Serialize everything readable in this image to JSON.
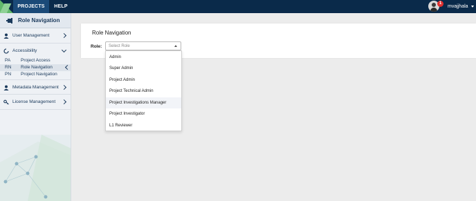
{
  "topbar": {
    "tabs": [
      {
        "label": "PROJECTS",
        "active": true
      },
      {
        "label": "HELP",
        "active": false
      }
    ],
    "notification_count": "1",
    "username": "mvajjhala"
  },
  "sidebar": {
    "title": "Role Navigation",
    "items": [
      {
        "label": "User Management",
        "icon": "user-icon"
      },
      {
        "label": "Accessibility",
        "icon": "accessibility-icon",
        "expanded": true
      },
      {
        "label": "Metadata Management",
        "icon": "user-icon"
      },
      {
        "label": "License Management",
        "icon": "key-icon"
      }
    ],
    "subitems": [
      {
        "abbr": "PA",
        "label": "Project Access"
      },
      {
        "abbr": "RN",
        "label": "Role Navigation",
        "active": true
      },
      {
        "abbr": "PN",
        "label": "Project Navigation"
      }
    ]
  },
  "main": {
    "card_title": "Role Navigation",
    "role_label": "Role:",
    "role_select": {
      "placeholder": "Select Role",
      "options": [
        "Admin",
        "Super Admin",
        "Project Admin",
        "Project Technical Admin",
        "Project Investigations Manager",
        "Project Investigator",
        "L1 Reviewer"
      ],
      "hovered_option": "Project Investigations Manager"
    }
  },
  "colors": {
    "topbar": "#0a2a4a",
    "active_tab": "#1b4a78",
    "sidebar_text": "#1b3a5c",
    "badge": "#e0302f",
    "logo": "#62b86c"
  }
}
